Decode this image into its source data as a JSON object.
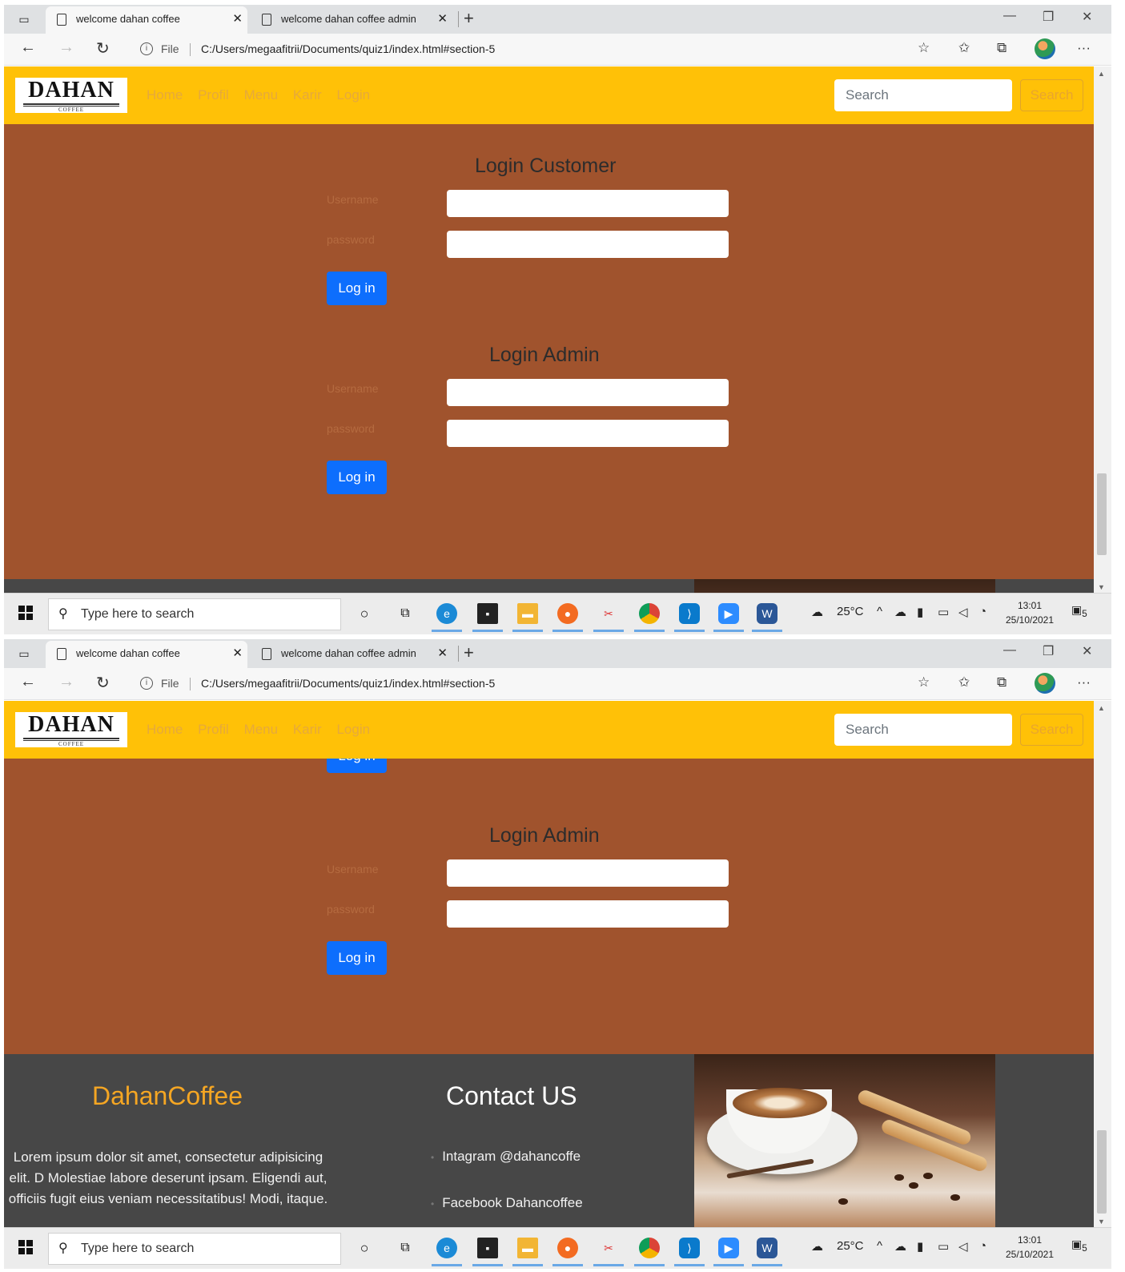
{
  "browser": {
    "tabs": [
      {
        "title": "welcome dahan coffee"
      },
      {
        "title": "welcome dahan coffee admin"
      }
    ],
    "file_label": "File",
    "url": "C:/Users/megaafitrii/Documents/quiz1/index.html#section-5"
  },
  "navbar": {
    "brand": "DAHAN",
    "brand_sub": "COFFEE",
    "links": [
      "Home",
      "Profil",
      "Menu",
      "Karir",
      "Login"
    ],
    "search_placeholder": "Search",
    "search_button": "Search"
  },
  "login_customer": {
    "title": "Login Customer",
    "username_label": "Username",
    "password_label": "password",
    "button": "Log in"
  },
  "login_admin": {
    "title": "Login Admin",
    "username_label": "Username",
    "password_label": "password",
    "button": "Log in"
  },
  "footer": {
    "brand": "DahanCoffee",
    "about": "Lorem ipsum dolor sit amet, consectetur adipisicing elit. D Molestiae labore deserunt ipsam. Eligendi aut, officiis fugit eius veniam necessitatibus! Modi, itaque.",
    "contact_title": "Contact US",
    "contacts": [
      "Intagram @dahancoffe",
      "Facebook Dahancoffee"
    ]
  },
  "taskbar": {
    "search_placeholder": "Type here to search",
    "weather": "25°C",
    "time": "13:01",
    "date": "25/10/2021",
    "notification_count": "5"
  },
  "colors": {
    "navbar": "#ffc107",
    "section_bg": "#a0532d",
    "footer_bg": "#474747",
    "login_button": "#0d6efd",
    "footer_brand": "#f5a623"
  }
}
